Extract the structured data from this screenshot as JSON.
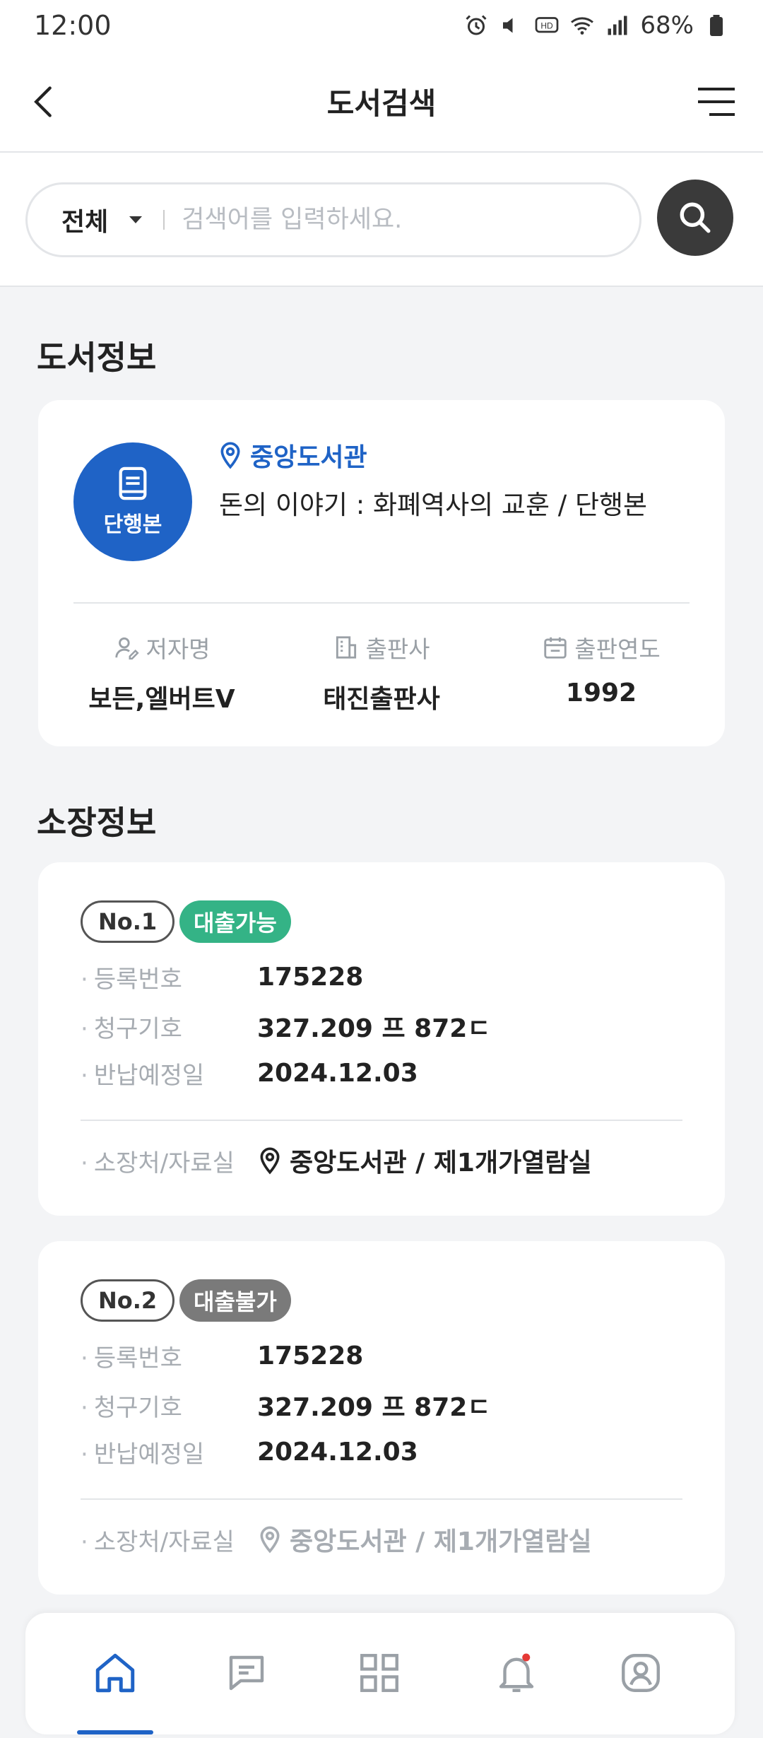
{
  "status": {
    "time": "12:00",
    "battery": "68%"
  },
  "header": {
    "title": "도서검색"
  },
  "search": {
    "scope": "전체",
    "placeholder": "검색어를 입력하세요."
  },
  "book_section": {
    "title": "도서정보",
    "badge": "단행본",
    "library": "중앙도서관",
    "book_title": "돈의 이야기 : 화폐역사의 교훈 / 단행본",
    "author_label": "저자명",
    "author": "보든,엘버트V",
    "publisher_label": "출판사",
    "publisher": "태진출판사",
    "year_label": "출판연도",
    "year": "1992"
  },
  "holding_section": {
    "title": "소장정보",
    "items": [
      {
        "no": "No.1",
        "status": "대출가능",
        "status_color": "#34b386",
        "reg_label": "등록번호",
        "reg_no": "175228",
        "call_label": "청구기호",
        "call_no": "327.209 프 872ㄷ",
        "due_label": "반납예정일",
        "due_date": "2024.12.03",
        "loc_label": "소장처/자료실",
        "location": "중앙도서관 / 제1개가열람실",
        "loc_color": "#222222"
      },
      {
        "no": "No.2",
        "status": "대출불가",
        "status_color": "#7a7a7a",
        "reg_label": "등록번호",
        "reg_no": "175228",
        "call_label": "청구기호",
        "call_no": "327.209 프 872ㄷ",
        "due_label": "반납예정일",
        "due_date": "2024.12.03",
        "loc_label": "소장처/자료실",
        "location": "중앙도서관 / 제1개가열람실",
        "loc_color": "#a7acb2"
      }
    ]
  },
  "bottom_nav": {
    "items": [
      "home-icon",
      "chat-icon",
      "grid-icon",
      "bell-icon",
      "profile-icon"
    ],
    "active": "home-icon",
    "accent": "#1f63c6",
    "notification_dot": "#e53935"
  }
}
